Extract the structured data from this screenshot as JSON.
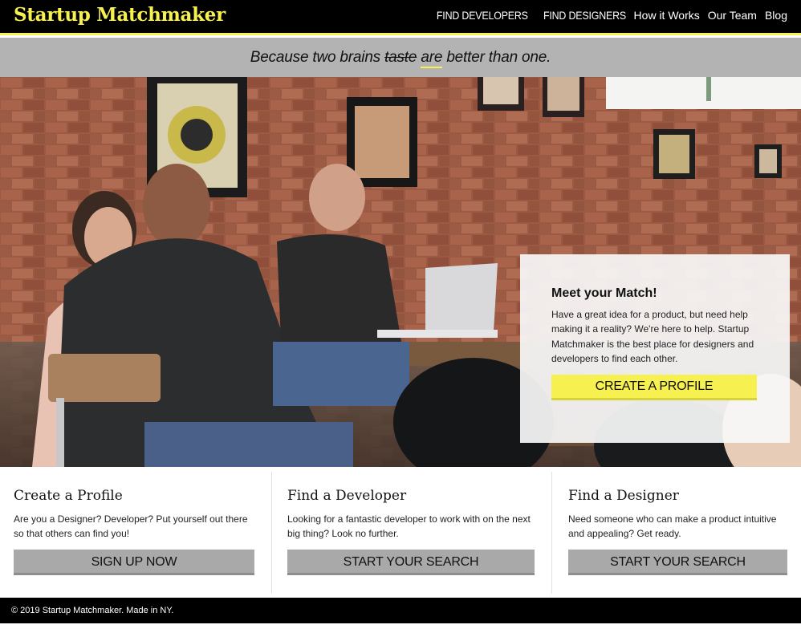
{
  "header": {
    "logo": "Startup Matchmaker",
    "nav": [
      "FIND DEVELOPERS",
      "FIND DESIGNERS",
      "How it Works",
      "Our Team",
      "Blog"
    ]
  },
  "tagline": {
    "before": "Because two brains ",
    "struck": "taste",
    "space": " ",
    "underlined": "are",
    "after": " better than one."
  },
  "hero": {
    "card_title": "Meet your Match!",
    "card_text": "Have a great idea for a product, but need help making it a reality? We're here to help. Startup Matchmaker is the best place for designers and developers to find each other.",
    "cta": "CREATE A PROFILE"
  },
  "features": [
    {
      "title": "Create a Profile",
      "text": "Are you a Designer? Developer? Put yourself out there so that others can find you!",
      "button": "SIGN UP NOW"
    },
    {
      "title": "Find a Developer",
      "text": "Looking for a fantastic developer to work with on the next big thing? Look no further.",
      "button": "START YOUR SEARCH"
    },
    {
      "title": "Find a Designer",
      "text": "Need someone who can make a product intuitive and appealing? Get ready.",
      "button": "START YOUR SEARCH"
    }
  ],
  "footer": {
    "text": "© 2019 Startup Matchmaker. Made in NY."
  },
  "colors": {
    "brand_yellow": "#f6f051",
    "header_bg": "#000000",
    "tagline_bg": "#b3b3b3",
    "button_gray": "#a9a9a9"
  }
}
